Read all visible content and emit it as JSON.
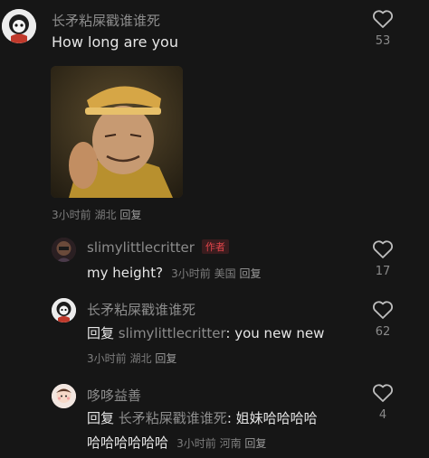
{
  "colors": {
    "background": "#161616",
    "author_tag": "#e0454a"
  },
  "comments": [
    {
      "username": "长矛粘屎戳谁谁死",
      "text": "How long are you",
      "image": "meme-photo",
      "meta": {
        "time": "3小时前",
        "location": "湖北",
        "reply": "回复"
      },
      "likes": "53"
    },
    {
      "username": "slimylittlecritter",
      "author_tag": "作者",
      "text": "my height?",
      "meta": {
        "time": "3小时前",
        "location": "美国",
        "reply": "回复"
      },
      "likes": "17"
    },
    {
      "username": "长矛粘屎戳谁谁死",
      "reply_prefix": "回复",
      "mention": "slimylittlecritter",
      "text": ": you new new",
      "meta": {
        "time": "3小时前",
        "location": "湖北",
        "reply": "回复"
      },
      "likes": "62"
    },
    {
      "username": "哆哆益善",
      "reply_prefix": "回复",
      "mention": "长矛粘屎戳谁谁死",
      "text": ": 姐妹哈哈哈哈",
      "text_line2": "哈哈哈哈哈哈",
      "meta": {
        "time": "3小时前",
        "location": "河南",
        "reply": "回复"
      },
      "likes": "4"
    }
  ]
}
